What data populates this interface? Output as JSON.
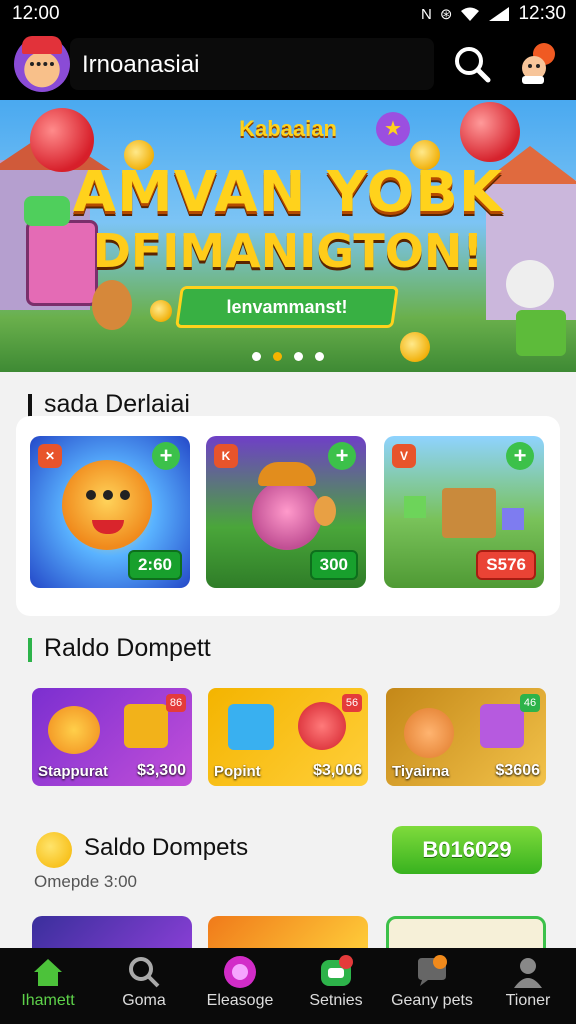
{
  "status_bar": {
    "time_left": "12:00",
    "time_right": "12:30",
    "icons": [
      "n-icon",
      "cast-icon",
      "wifi-icon",
      "signal-icon"
    ]
  },
  "header": {
    "app_name": "Irnoanasiai",
    "search_icon": "search-icon",
    "mascot_icon": "mascot-icon"
  },
  "banner": {
    "kicker": "Kabaaian",
    "headline_line1": "AMVAN YOBK",
    "headline_line2": "DFIMANIGTON!",
    "ribbon": "lenvammanst!",
    "slides": 4,
    "active_slide": 2
  },
  "section1": {
    "title": "sada Derlaiai",
    "games": [
      {
        "badge": "2:60",
        "tag": "✕"
      },
      {
        "badge": "300",
        "tag": "K"
      },
      {
        "badge": "S576",
        "tag": "V"
      }
    ]
  },
  "section2": {
    "title": "Raldo Dompett",
    "wallets": [
      {
        "name": "Stappurat",
        "amount": "$3,300",
        "mini": "86"
      },
      {
        "name": "Popint",
        "amount": "$3,006",
        "mini": "56"
      },
      {
        "name": "Tiyairna",
        "amount": "$3606",
        "mini": "46"
      }
    ]
  },
  "saldo": {
    "title": "Saldo Dompets",
    "subtitle": "Omepde 3:00",
    "button": "B016029"
  },
  "nav": {
    "items": [
      {
        "label": "Ihamett",
        "icon": "home-icon"
      },
      {
        "label": "Goma",
        "icon": "search-icon"
      },
      {
        "label": "Eleasoge",
        "icon": "orb-icon"
      },
      {
        "label": "Setnies",
        "icon": "wallet-icon"
      },
      {
        "label": "Geany pets",
        "icon": "chat-icon"
      },
      {
        "label": "Tioner",
        "icon": "user-icon"
      }
    ]
  },
  "colors": {
    "accent_green": "#38b21f",
    "gold": "#ffd21c",
    "nav_bg": "#0a0a0a"
  }
}
